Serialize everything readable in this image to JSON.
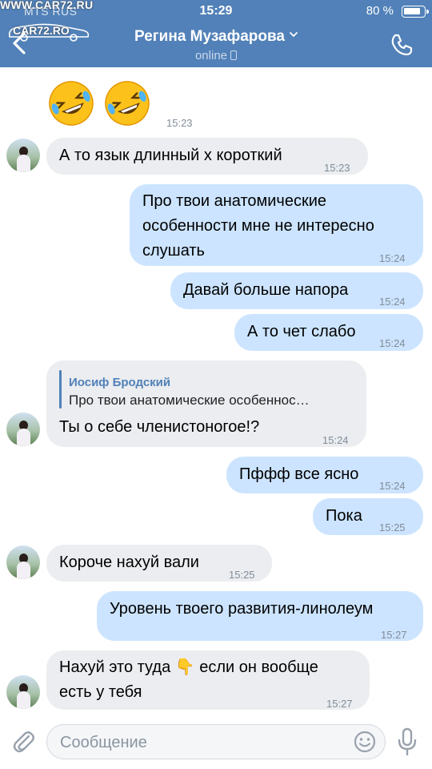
{
  "status_bar": {
    "carrier": "MTS RUS",
    "watermark": "WWW.CAR72.RU",
    "time": "15:29",
    "battery": "80 %"
  },
  "logo_text": "CAR72.RO",
  "header": {
    "contact_name": "Регина Музафарова",
    "contact_status": "online"
  },
  "messages": [
    {
      "dir": "in",
      "type": "emoji",
      "text": "🤣🤣",
      "time": "15:23"
    },
    {
      "dir": "in",
      "text": "А то язык длинный х короткий",
      "time": "15:23"
    },
    {
      "dir": "out",
      "text": "Про твои анатомические\nособенности мне не интересно\nслушать",
      "time": "15:24"
    },
    {
      "dir": "out",
      "text": "Давай больше напора",
      "time": "15:24"
    },
    {
      "dir": "out",
      "text": "А то чет слабо",
      "time": "15:24"
    },
    {
      "dir": "in",
      "reply_name": "Иосиф Бродский",
      "reply_text": "Про твои анатомические особеннос…",
      "text": "Ты о себе членистоногое!?",
      "time": "15:24"
    },
    {
      "dir": "out",
      "text": "Пффф все ясно",
      "time": "15:24"
    },
    {
      "dir": "out",
      "text": "Пока",
      "time": "15:25"
    },
    {
      "dir": "in",
      "text": "Короче нахуй вали",
      "time": "15:25"
    },
    {
      "dir": "out",
      "text": "Уровень твоего развития-линолеум",
      "time": "15:27"
    },
    {
      "dir": "in",
      "text": "Нахуй это туда 👇 если он вообще\nесть у тебя",
      "time": "15:27"
    }
  ],
  "composer": {
    "placeholder": "Сообщение"
  },
  "icons": {
    "back": "chevron-left-icon",
    "call": "phone-icon",
    "attach": "paperclip-icon",
    "emoji": "smile-icon",
    "mic": "microphone-icon"
  },
  "colors": {
    "header": "#5181b8",
    "incoming_bubble": "#ebedf0",
    "outgoing_bubble": "#cce4ff",
    "time_text": "#818c99"
  }
}
